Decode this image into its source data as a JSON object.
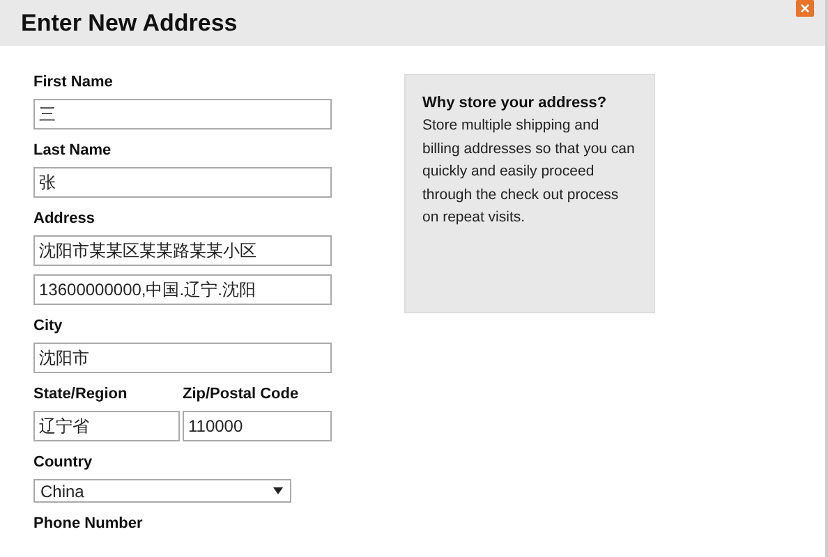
{
  "window": {
    "title": "Enter New Address",
    "close": "×"
  },
  "fields": [
    {
      "kind": "text",
      "label": "First Name",
      "values": [
        "三"
      ]
    },
    {
      "kind": "text",
      "label": "Last Name",
      "values": [
        "张"
      ]
    },
    {
      "kind": "text",
      "label": "Address",
      "values": [
        "沈阳市某某区某某路某某小区",
        "13600000000,中国.辽宁.沈阳"
      ]
    },
    {
      "kind": "text",
      "label": "City",
      "values": [
        "沈阳市"
      ]
    },
    {
      "kind": "pair",
      "parts": [
        {
          "label": "State/Region",
          "value": "辽宁省"
        },
        {
          "label": "Zip/Postal Code",
          "value": "110000"
        }
      ]
    },
    {
      "kind": "select",
      "label": "Country",
      "value": "China"
    },
    {
      "kind": "label",
      "label": "Phone Number"
    }
  ],
  "info": {
    "title": "Why store your address?",
    "text": "Store multiple shipping and billing addresses so that you can quickly and easily proceed through the check out process on repeat visits."
  }
}
